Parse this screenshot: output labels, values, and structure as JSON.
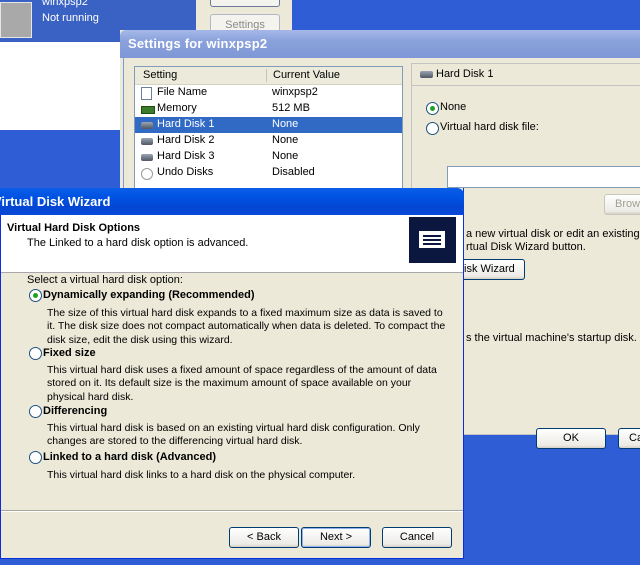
{
  "vpc_main": {
    "vm_name": "winxpsp2",
    "vm_status": "Not running",
    "settings_button": "Settings"
  },
  "settings": {
    "title": "Settings for winxpsp2",
    "columns": [
      "Setting",
      "Current Value"
    ],
    "rows": [
      {
        "label": "File Name",
        "value": "winxpsp2",
        "icon": "file-icon"
      },
      {
        "label": "Memory",
        "value": "512 MB",
        "icon": "memory-icon"
      },
      {
        "label": "Hard Disk 1",
        "value": "None",
        "icon": "hard-disk-icon",
        "selected": true
      },
      {
        "label": "Hard Disk 2",
        "value": "None",
        "icon": "hard-disk-icon"
      },
      {
        "label": "Hard Disk 3",
        "value": "None",
        "icon": "hard-disk-icon"
      },
      {
        "label": "Undo Disks",
        "value": "Disabled",
        "icon": "undo-icon"
      }
    ],
    "panel": {
      "title": "Hard Disk 1",
      "radio_none": "None",
      "radio_file": "Virtual hard disk file:",
      "browse_button": "Brows",
      "desc_line1": "a new virtual disk or edit an existing or",
      "desc_line2": "rtual Disk Wizard button.",
      "wizard_button": "isk Wizard",
      "startup_note": "s the virtual machine's startup disk.",
      "ok_button": "OK",
      "cancel_button": "Ca"
    }
  },
  "wizard": {
    "title": "Virtual Disk Wizard",
    "header_title": "Virtual Hard Disk Options",
    "header_subtitle": "The Linked to a hard disk option is advanced.",
    "select_label": "Select a virtual hard disk option:",
    "options": [
      {
        "title": "Dynamically expanding (Recommended)",
        "selected": true,
        "desc": "The size of this virtual hard disk expands to a fixed maximum size as data is saved to it. The disk size does not compact automatically when data is deleted. To compact the disk size, edit the disk using this wizard."
      },
      {
        "title": "Fixed size",
        "selected": false,
        "desc": "This virtual hard disk uses a fixed amount of space regardless of the amount of data stored on it. Its default size is the maximum amount of space available on your physical hard disk."
      },
      {
        "title": "Differencing",
        "selected": false,
        "desc": "This virtual hard disk is based on an existing virtual hard disk configuration. Only changes are stored to the differencing virtual hard disk."
      },
      {
        "title": "Linked to a hard disk (Advanced)",
        "selected": false,
        "desc": "This virtual hard disk links to a hard disk on the physical computer."
      }
    ],
    "back_button": "< Back",
    "next_button": "Next >",
    "cancel_button": "Cancel"
  }
}
